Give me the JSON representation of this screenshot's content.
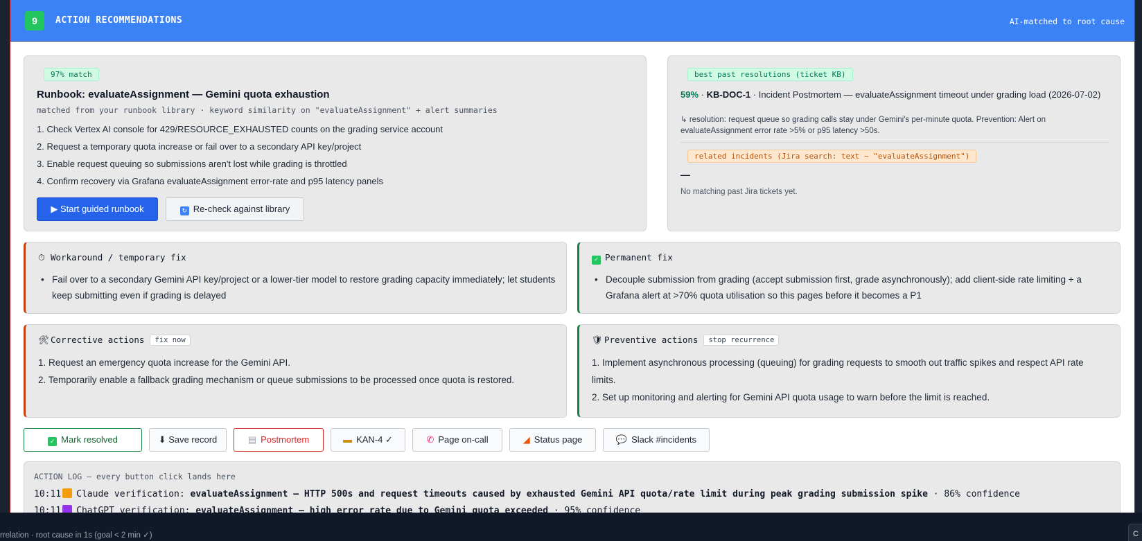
{
  "header": {
    "step_number": "9",
    "title": "ACTION RECOMMENDATIONS",
    "right_text": "AI-matched to root cause"
  },
  "runbook": {
    "match_tag": "97% match",
    "title": "Runbook: evaluateAssignment — Gemini quota exhaustion",
    "subtitle": "matched from your runbook library · keyword similarity on \"evaluateAssignment\" + alert summaries",
    "steps": [
      "1. Check Vertex AI console for 429/RESOURCE_EXHAUSTED counts on the grading service account",
      "2. Request a temporary quota increase or fail over to a secondary API key/project",
      "3. Enable request queuing so submissions aren't lost while grading is throttled",
      "4. Confirm recovery via Grafana evaluateAssignment error-rate and p95 latency panels"
    ],
    "start_button": "▶ Start guided runbook",
    "recheck_button": "Re-check against library"
  },
  "kb": {
    "tag": "best past resolutions (ticket KB)",
    "percent": "59%",
    "doc_id": "KB-DOC-1",
    "doc_title": "Incident Postmortem — evaluateAssignment timeout under grading load (2026-07-02)",
    "resolution": "↳ resolution: request queue so grading calls stay under Gemini's per-minute quota. Prevention: Alert on evaluateAssignment error rate >5% or p95 latency >50s.",
    "related_tag": "related incidents (Jira search: text ~ \"evaluateAssignment\")",
    "related_dash": "—",
    "related_empty": "No matching past Jira tickets yet."
  },
  "workaround": {
    "icon": "⏱",
    "title": "Workaround / temporary fix",
    "text": "Fail over to a secondary Gemini API key/project or a lower-tier model to restore grading capacity immediately; let students keep submitting even if grading is delayed"
  },
  "permanent": {
    "icon": "✓",
    "title": "Permanent fix",
    "text": "Decouple submission from grading (accept submission first, grade asynchronously); add client-side rate limiting + a Grafana alert at >70% quota utilisation so this pages before it becomes a P1"
  },
  "corrective": {
    "icon": "🛠",
    "title": "Corrective actions",
    "tag": "fix now",
    "items": [
      "1. Request an emergency quota increase for the Gemini API.",
      "2. Temporarily enable a fallback grading mechanism or queue submissions to be processed once quota is restored."
    ]
  },
  "preventive": {
    "icon": "🛡",
    "title": "Preventive actions",
    "tag": "stop recurrence",
    "items": [
      "1. Implement asynchronous processing (queuing) for grading requests to smooth out traffic spikes and respect API rate limits.",
      "2. Set up monitoring and alerting for Gemini API quota usage to warn before the limit is reached."
    ]
  },
  "action_buttons": {
    "resolved": "Mark resolved",
    "save": "⬇ Save record",
    "postmortem": "Postmortem",
    "jira": "KAN-4 ✓",
    "page": "Page on-call",
    "status": "Status page",
    "slack": "Slack #incidents"
  },
  "log": {
    "header": "ACTION LOG — every button click lands here",
    "rows": [
      {
        "time": "10:11",
        "prefix": "Claude verification: ",
        "bold": "evaluateAssignment — HTTP 500s and request timeouts caused by exhausted Gemini API quota/rate limit during peak grading submission spike",
        "suffix": " · 86% confidence"
      },
      {
        "time": "10:11",
        "prefix": "ChatGPT verification: ",
        "bold": "evaluateAssignment — high error rate due to Gemini quota exceeded",
        "suffix": " · 95% confidence"
      }
    ]
  },
  "statusbar": {
    "text": "rrelation · root cause in 1s (goal < 2 min ✓)",
    "button": "C"
  },
  "colors": {
    "header_blue": "#3b82f6",
    "primary_button": "#2563eb",
    "workaround_accent": "#c2410c",
    "permanent_accent": "#15803d",
    "postmortem_red": "#dc2626"
  }
}
